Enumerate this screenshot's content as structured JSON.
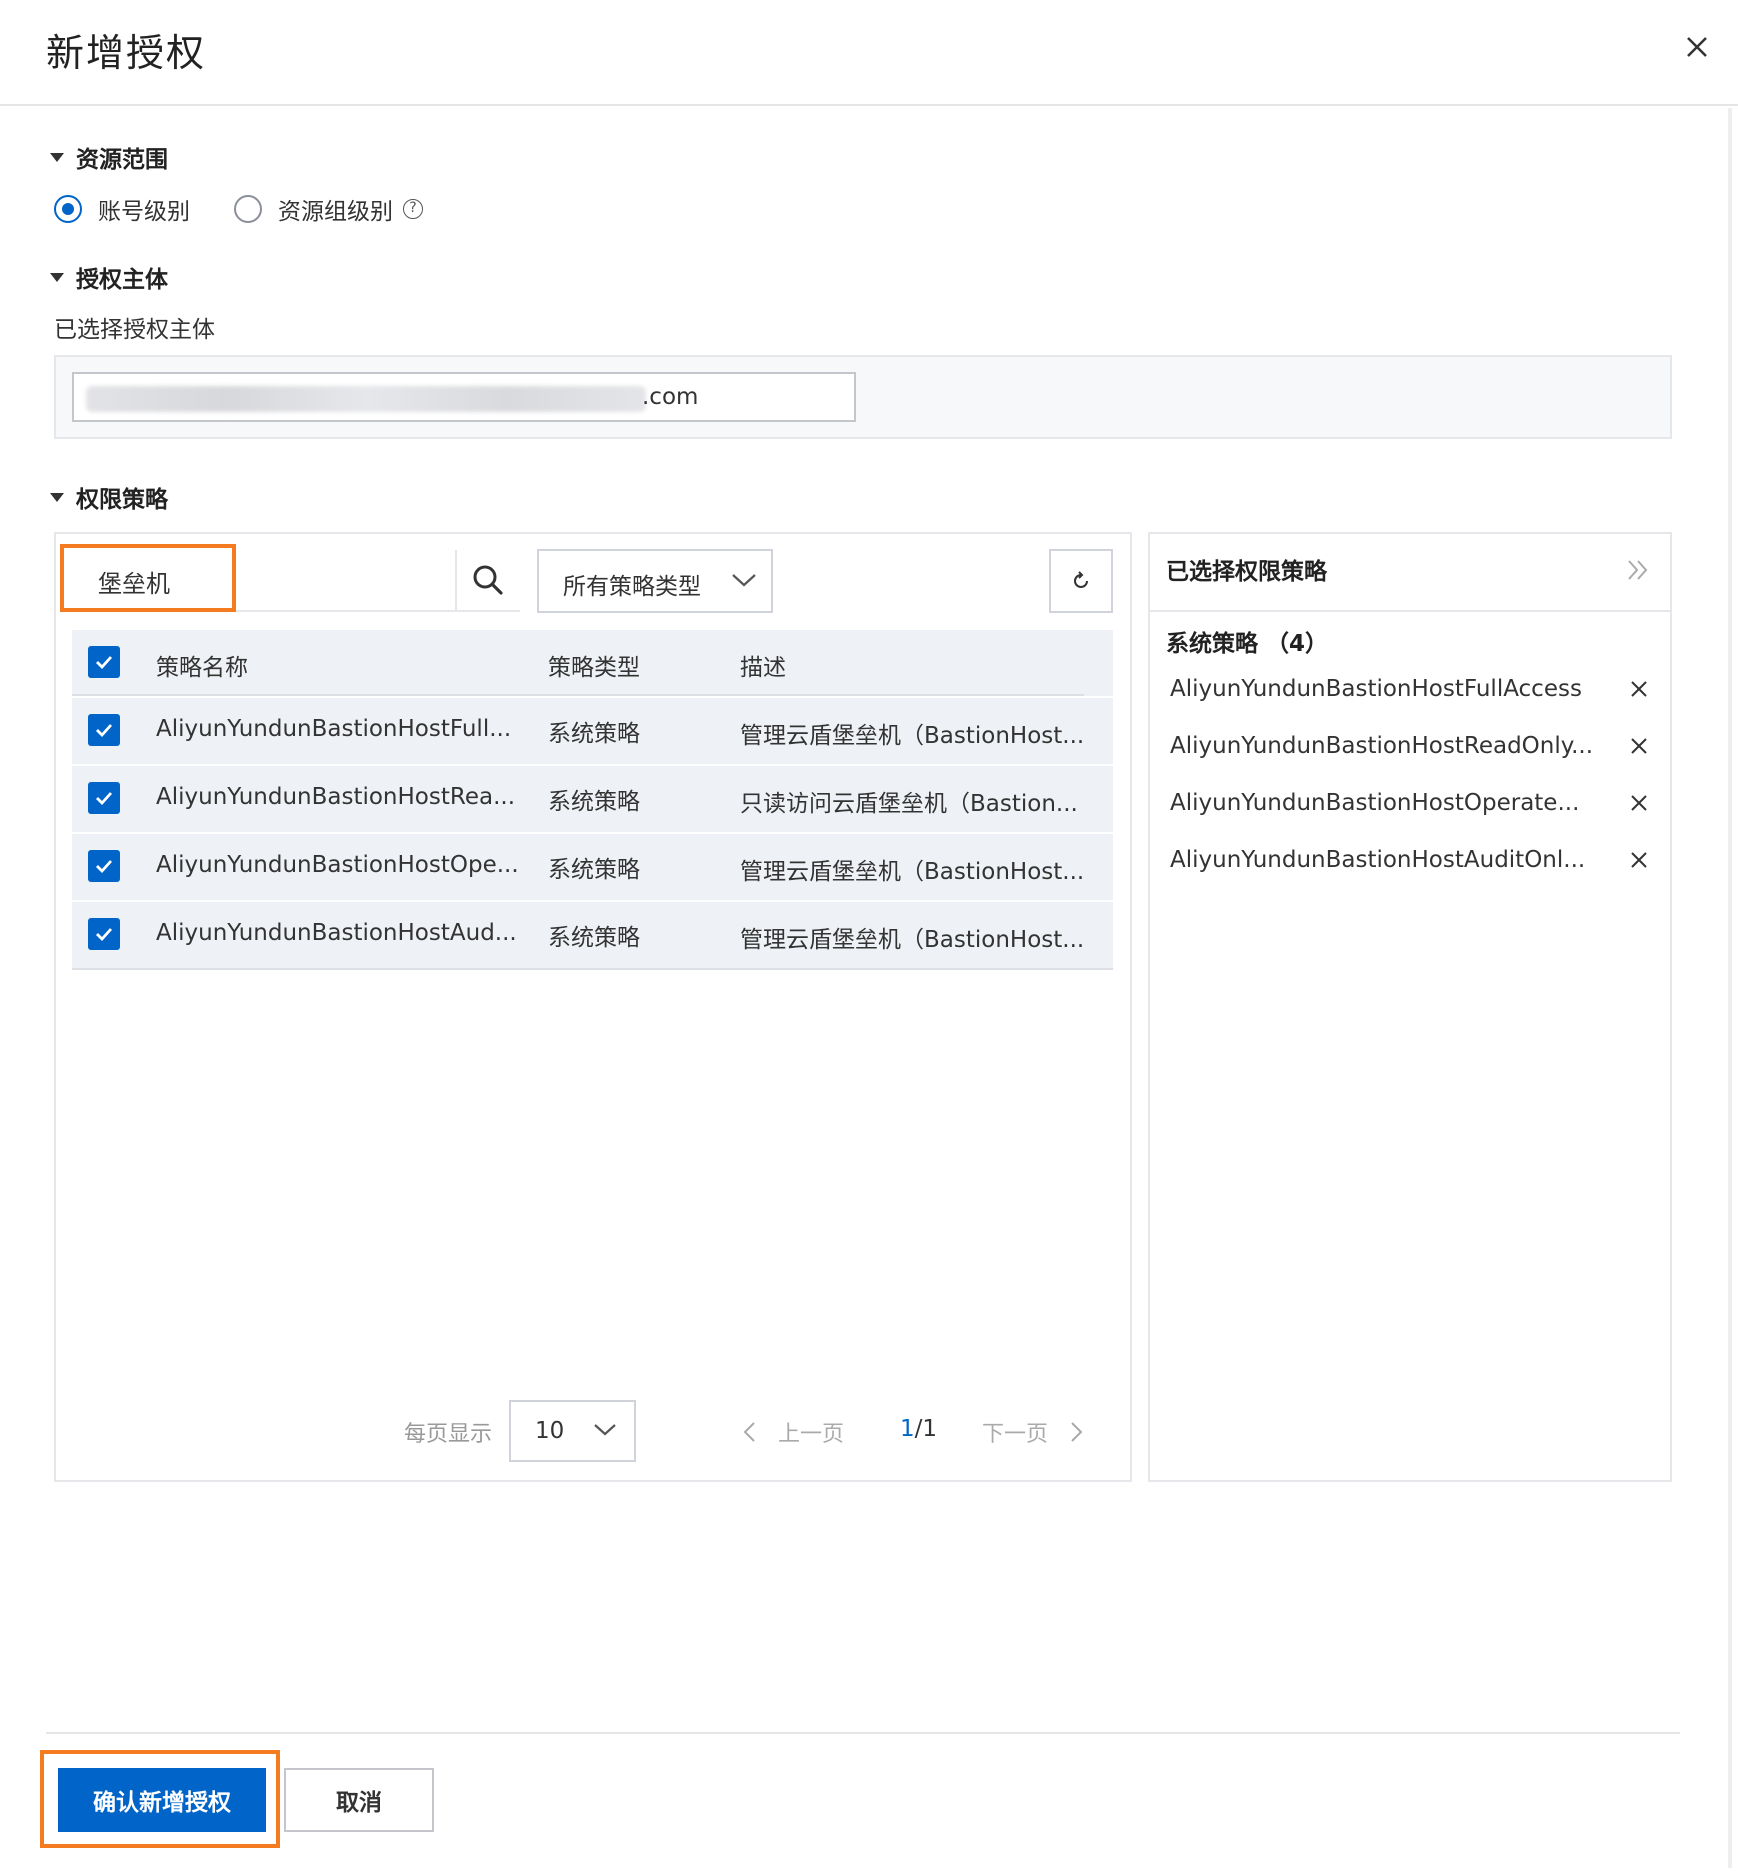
{
  "dialog": {
    "title": "新增授权"
  },
  "scope": {
    "heading": "资源范围",
    "options": [
      {
        "label": "账号级别",
        "selected": true
      },
      {
        "label": "资源组级别",
        "selected": false
      }
    ]
  },
  "principal": {
    "heading": "授权主体",
    "selected_label": "已选择授权主体",
    "value_suffix": ".com"
  },
  "policy": {
    "heading": "权限策略",
    "search_value": "堡垒机",
    "type_filter": "所有策略类型",
    "columns": [
      "策略名称",
      "策略类型",
      "描述"
    ],
    "rows": [
      {
        "name": "AliyunYundunBastionHostFull...",
        "type": "系统策略",
        "desc": "管理云盾堡垒机（BastionHost..."
      },
      {
        "name": "AliyunYundunBastionHostRea...",
        "type": "系统策略",
        "desc": "只读访问云盾堡垒机（Bastion..."
      },
      {
        "name": "AliyunYundunBastionHostOpe...",
        "type": "系统策略",
        "desc": "管理云盾堡垒机（BastionHost..."
      },
      {
        "name": "AliyunYundunBastionHostAud...",
        "type": "系统策略",
        "desc": "管理云盾堡垒机（BastionHost..."
      }
    ],
    "pagination": {
      "per_page_label": "每页显示",
      "per_page": "10",
      "prev": "上一页",
      "current": "1",
      "total": "/1",
      "next": "下一页"
    }
  },
  "selected_panel": {
    "title": "已选择权限策略",
    "group_label": "系统策略 （4）",
    "items": [
      "AliyunYundunBastionHostFullAccess",
      "AliyunYundunBastionHostReadOnly...",
      "AliyunYundunBastionHostOperate...",
      "AliyunYundunBastionHostAuditOnl..."
    ]
  },
  "footer": {
    "confirm": "确认新增授权",
    "cancel": "取消"
  },
  "colors": {
    "primary": "#0064c8",
    "highlight": "#f47b20"
  },
  "icons": [
    "close-icon",
    "help-icon",
    "search-icon",
    "chevron-down-icon",
    "refresh-icon",
    "double-chevron-right-icon",
    "chevron-left-icon",
    "chevron-right-icon",
    "checkmark-icon"
  ]
}
